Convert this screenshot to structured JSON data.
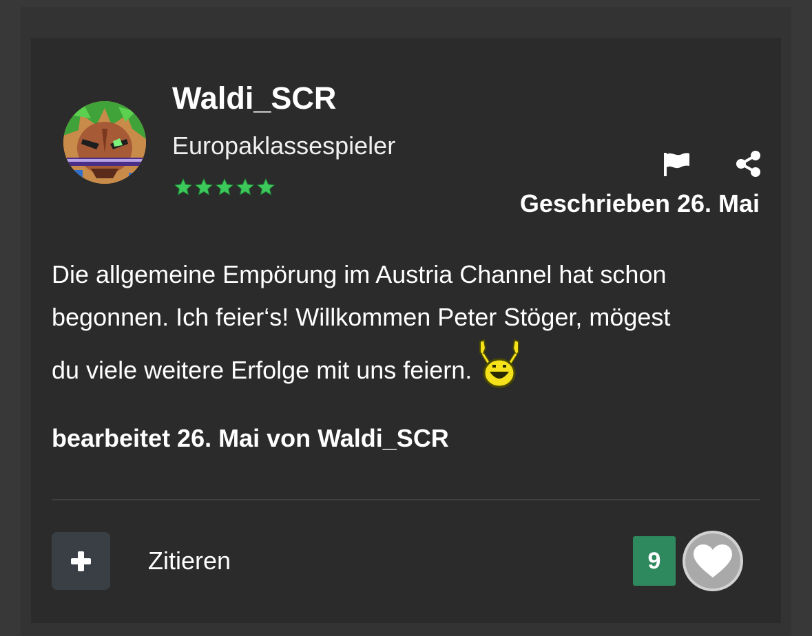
{
  "post": {
    "author": {
      "name": "Waldi_SCR",
      "rank": "Europaklassespieler",
      "rating_stars": 5,
      "avatar": "anime-character-avatar"
    },
    "actions": {
      "report_icon": "flag-icon",
      "share_icon": "share-icon"
    },
    "date_label": "Geschrieben 26. Mai",
    "body": {
      "line1": "Die allgemeine Empörung im Austria Channel hat schon",
      "line2": "begonnen. Ich feier‘s! Willkommen Peter Stöger, mögest",
      "line3": "du viele weitere Erfolge mit uns feiern.",
      "emoji": "cheering-smiley"
    },
    "edited_note": "bearbeitet 26. Mai von Waldi_SCR",
    "footer": {
      "multiquote_icon": "plus-icon",
      "quote_label": "Zitieren",
      "reaction_count": "9",
      "like_icon": "heart-icon"
    }
  },
  "colors": {
    "page_background": "#383838",
    "card_background": "#2b2b2b",
    "text": "#ffffff",
    "stars": "#3cc85a",
    "reaction_badge": "#2e8a5e",
    "multiquote_button": "#3a3f45"
  }
}
